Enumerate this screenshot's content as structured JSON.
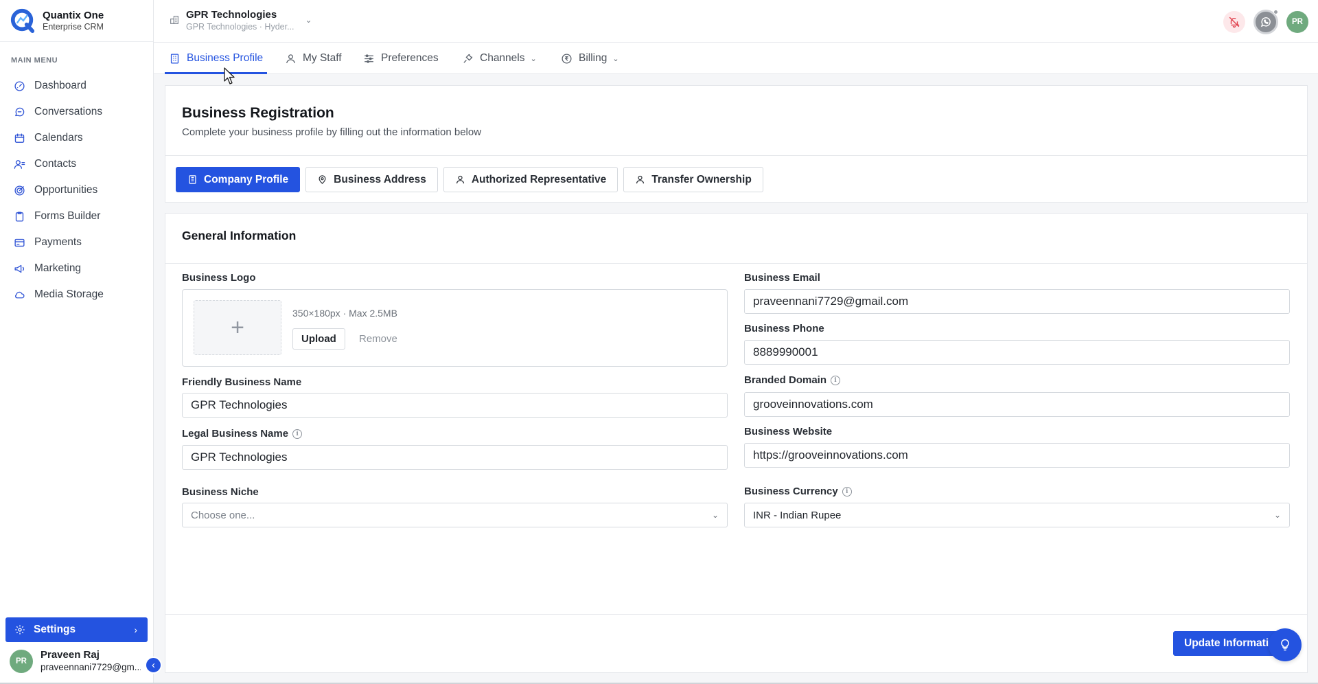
{
  "brand": {
    "name": "Quantix One",
    "subtitle": "Enterprise CRM"
  },
  "sidebar": {
    "menu_label": "MAIN MENU",
    "items": [
      {
        "label": "Dashboard",
        "icon": "gauge-icon"
      },
      {
        "label": "Conversations",
        "icon": "chat-icon"
      },
      {
        "label": "Calendars",
        "icon": "calendar-icon"
      },
      {
        "label": "Contacts",
        "icon": "contacts-icon"
      },
      {
        "label": "Opportunities",
        "icon": "target-icon"
      },
      {
        "label": "Forms Builder",
        "icon": "clipboard-icon"
      },
      {
        "label": "Payments",
        "icon": "card-icon"
      },
      {
        "label": "Marketing",
        "icon": "megaphone-icon"
      },
      {
        "label": "Media Storage",
        "icon": "cloud-icon"
      }
    ],
    "settings_label": "Settings",
    "user": {
      "initials": "PR",
      "name": "Praveen Raj",
      "email": "praveennani7729@gm..."
    }
  },
  "header": {
    "org_name": "GPR Technologies",
    "org_sub": "GPR Technologies · Hyder...",
    "avatar_initials": "PR"
  },
  "tabs": [
    {
      "label": "Business Profile",
      "active": true
    },
    {
      "label": "My Staff"
    },
    {
      "label": "Preferences"
    },
    {
      "label": "Channels",
      "dropdown": true
    },
    {
      "label": "Billing",
      "dropdown": true
    }
  ],
  "registration": {
    "title": "Business Registration",
    "subtitle": "Complete your business profile by filling out the information below",
    "subtabs": [
      "Company Profile",
      "Business Address",
      "Authorized Representative",
      "Transfer Ownership"
    ]
  },
  "general": {
    "title": "General Information",
    "logo": {
      "label": "Business Logo",
      "hint": "350×180px · Max 2.5MB",
      "upload": "Upload",
      "remove": "Remove"
    },
    "friendly_name": {
      "label": "Friendly Business Name",
      "value": "GPR Technologies"
    },
    "legal_name": {
      "label": "Legal Business Name",
      "value": "GPR Technologies"
    },
    "niche": {
      "label": "Business Niche",
      "placeholder": "Choose one..."
    },
    "email": {
      "label": "Business Email",
      "value": "praveennani7729@gmail.com"
    },
    "phone": {
      "label": "Business Phone",
      "value": "8889990001"
    },
    "domain": {
      "label": "Branded Domain",
      "value": "grooveinnovations.com"
    },
    "website": {
      "label": "Business Website",
      "value": "https://grooveinnovations.com"
    },
    "currency": {
      "label": "Business Currency",
      "value": "INR - Indian Rupee"
    },
    "update_button": "Update Information"
  },
  "colors": {
    "primary": "#2453e0",
    "avatar": "#6faa7e",
    "bell_bg": "#fde8ea"
  }
}
